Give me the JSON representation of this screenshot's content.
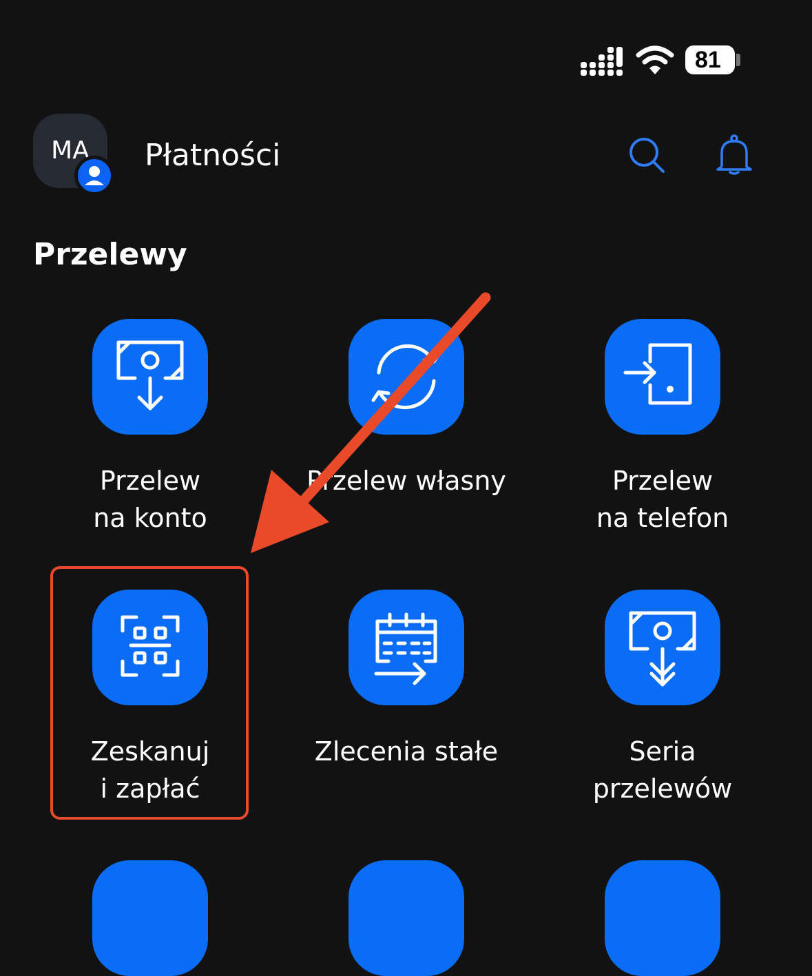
{
  "status_bar": {
    "battery_level": "81",
    "battery_fill": 0.81,
    "signal_icon": "cellular-signal-icon",
    "wifi_icon": "wifi-icon"
  },
  "header": {
    "avatar_initials": "MA",
    "title": "Płatności",
    "search_icon": "search-icon",
    "bell_icon": "bell-icon"
  },
  "section": {
    "title": "Przelewy"
  },
  "tiles": [
    {
      "icon": "transfer-to-account-icon",
      "label_lines": [
        "Przelew",
        "na konto"
      ]
    },
    {
      "icon": "own-transfer-icon",
      "label_lines": [
        "Przelew własny"
      ]
    },
    {
      "icon": "transfer-to-phone-icon",
      "label_lines": [
        "Przelew",
        "na telefon"
      ]
    },
    {
      "icon": "qr-scan-icon",
      "label_lines": [
        "Zeskanuj",
        "i zapłać"
      ]
    },
    {
      "icon": "standing-orders-icon",
      "label_lines": [
        "Zlecenia stałe"
      ]
    },
    {
      "icon": "batch-transfers-icon",
      "label_lines": [
        "Seria",
        "przelewów"
      ]
    }
  ],
  "colors": {
    "background": "#121212",
    "accent": "#0b6df6",
    "icon_blue": "#2f7cf6",
    "annotation": "#e84a2a"
  }
}
